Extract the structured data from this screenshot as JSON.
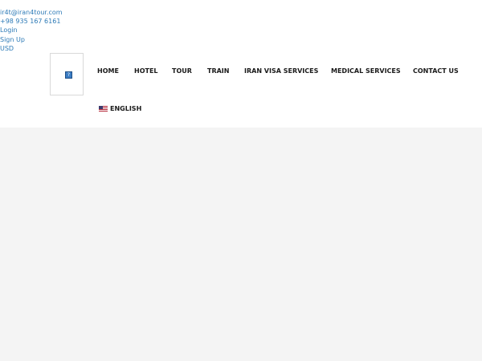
{
  "topbar": {
    "email": "ir4t@iran4tour.com",
    "phone": "+98 935 167 6161",
    "login": "Login",
    "signup": "Sign Up",
    "currency": "USD"
  },
  "logo": {
    "icon": "broken-image-icon"
  },
  "nav": {
    "items": [
      "HOME",
      "HOTEL",
      "TOUR",
      "TRAIN",
      "IRAN VISA SERVICES",
      "MEDICAL SERVICES",
      "CONTACT US"
    ]
  },
  "language": {
    "label": "ENGLISH",
    "icon": "us-flag-icon"
  },
  "colors": {
    "link": "#2e7bb7",
    "nav_text": "#1a1a1a",
    "page_bg": "#f4f4f4",
    "header_bg": "#ffffff"
  }
}
